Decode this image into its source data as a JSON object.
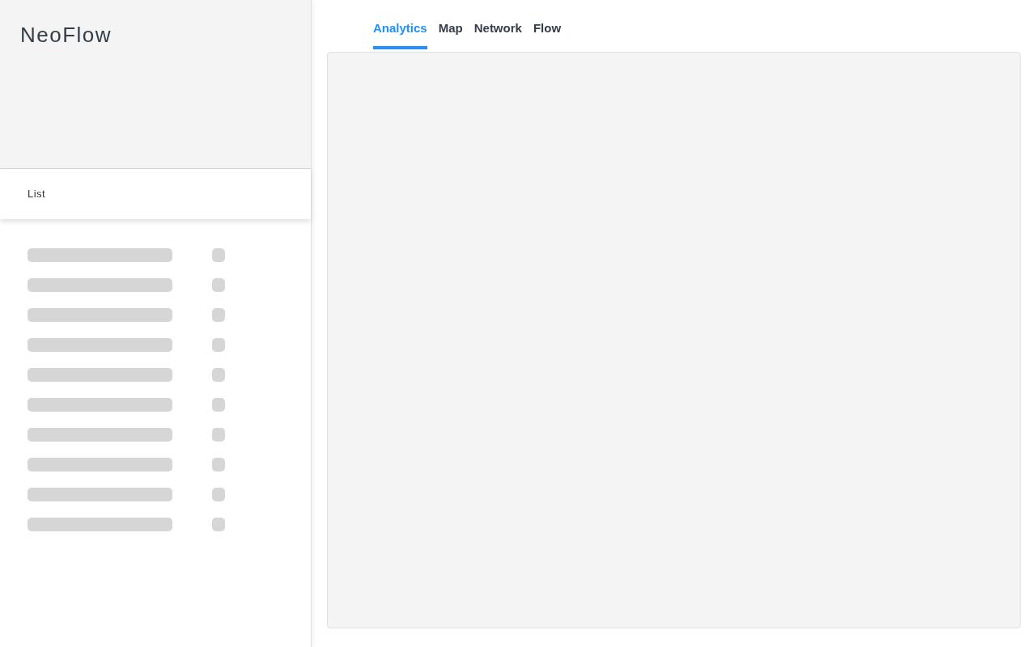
{
  "sidebar": {
    "brand": "NeoFlow",
    "list_header": "List",
    "rows": [
      {
        "kind": "skeleton"
      },
      {
        "kind": "skeleton"
      },
      {
        "kind": "skeleton"
      },
      {
        "kind": "skeleton"
      },
      {
        "kind": "skeleton"
      },
      {
        "kind": "skeleton"
      },
      {
        "kind": "skeleton"
      },
      {
        "kind": "skeleton"
      },
      {
        "kind": "skeleton"
      },
      {
        "kind": "skeleton"
      }
    ]
  },
  "tabs": [
    {
      "label": "Analytics",
      "selected": true
    },
    {
      "label": "Map",
      "selected": false
    },
    {
      "label": "Network",
      "selected": false
    },
    {
      "label": "Flow",
      "selected": false
    }
  ]
}
